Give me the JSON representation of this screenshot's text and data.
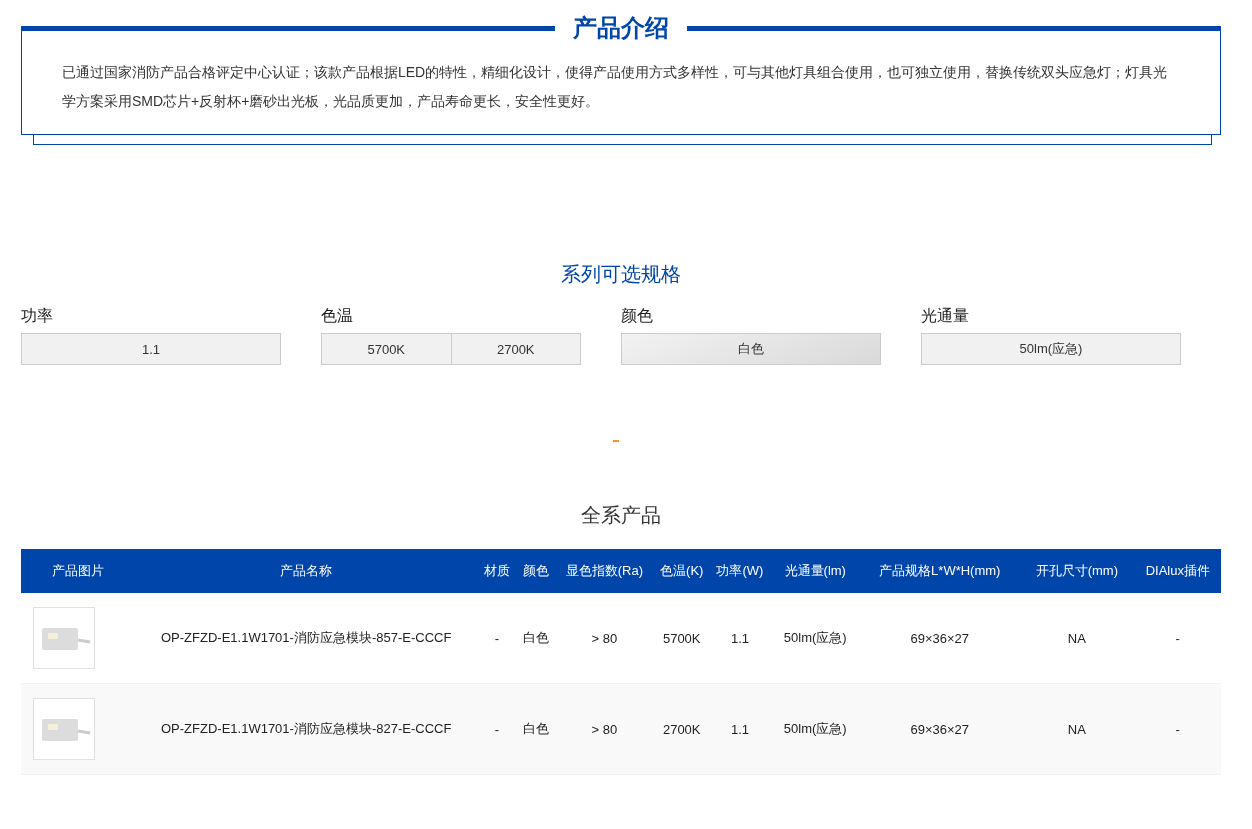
{
  "intro": {
    "title": "产品介绍",
    "text": "已通过国家消防产品合格评定中心认证；该款产品根据LED的特性，精细化设计，使得产品使用方式多样性，可与其他灯具组合使用，也可独立使用，替换传统双头应急灯；灯具光学方案采用SMD芯片+反射杯+磨砂出光板，光品质更加，产品寿命更长，安全性更好。"
  },
  "specs": {
    "title": "系列可选规格",
    "groups": [
      {
        "label": "功率",
        "options": [
          {
            "label": "1.1",
            "selected": false
          }
        ]
      },
      {
        "label": "色温",
        "options": [
          {
            "label": "5700K",
            "selected": false
          },
          {
            "label": "2700K",
            "selected": false
          }
        ]
      },
      {
        "label": "颜色",
        "options": [
          {
            "label": "白色",
            "selected": true
          }
        ]
      },
      {
        "label": "光通量",
        "options": [
          {
            "label": "50lm(应急)",
            "selected": false
          }
        ]
      }
    ]
  },
  "products": {
    "title": "全系产品",
    "columns": [
      "产品图片",
      "产品名称",
      "材质",
      "颜色",
      "显色指数(Ra)",
      "色温(K)",
      "功率(W)",
      "光通量(lm)",
      "产品规格L*W*H(mm)",
      "开孔尺寸(mm)",
      "DIAlux插件"
    ],
    "rows": [
      {
        "cells": [
          "",
          "OP-ZFZD-E1.1W1701-消防应急模块-857-E-CCCF",
          "-",
          "白色",
          "> 80",
          "5700K",
          "1.1",
          "50lm(应急)",
          "69×36×27",
          "NA",
          "-"
        ]
      },
      {
        "cells": [
          "",
          "OP-ZFZD-E1.1W1701-消防应急模块-827-E-CCCF",
          "-",
          "白色",
          "> 80",
          "2700K",
          "1.1",
          "50lm(应急)",
          "69×36×27",
          "NA",
          "-"
        ]
      }
    ]
  }
}
